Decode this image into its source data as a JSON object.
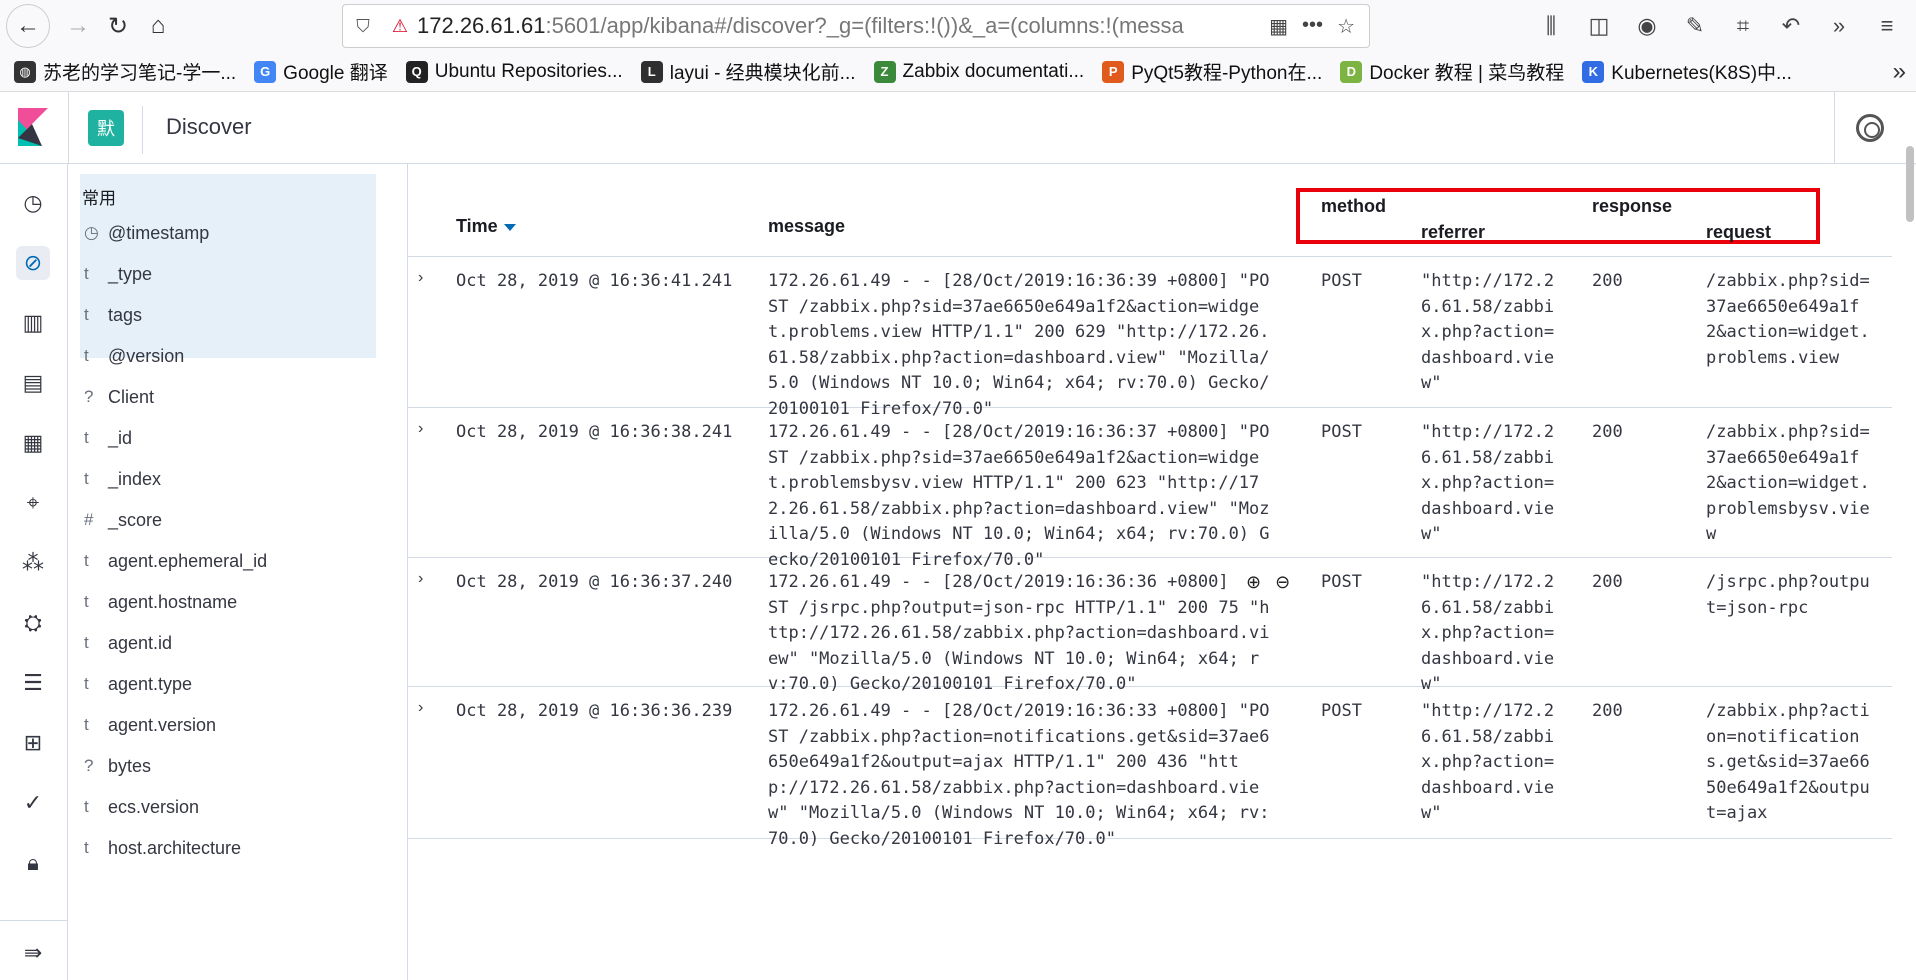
{
  "browser": {
    "url_host": "172.26.61.61",
    "url_rest": ":5601/app/kibana#/discover?_g=(filters:!())&_a=(columns:!(messa",
    "bookmarks": [
      {
        "label": "苏老的学习笔记-学一...",
        "color": "#333333",
        "glyph": "◍"
      },
      {
        "label": "Google 翻译",
        "color": "#4285f4",
        "glyph": "G"
      },
      {
        "label": "Ubuntu Repositories...",
        "color": "#222222",
        "glyph": "Q"
      },
      {
        "label": "layui - 经典模块化前...",
        "color": "#2f2f2f",
        "glyph": "L"
      },
      {
        "label": "Zabbix documentati...",
        "color": "#3b8a3b",
        "glyph": "Z"
      },
      {
        "label": "PyQt5教程-Python在...",
        "color": "#e05a1e",
        "glyph": "P"
      },
      {
        "label": "Docker 教程 | 菜鸟教程",
        "color": "#7cb342",
        "glyph": "D"
      },
      {
        "label": "Kubernetes(K8S)中...",
        "color": "#326ce5",
        "glyph": "K"
      }
    ]
  },
  "kibana": {
    "space_initial": "默",
    "page_title": "Discover"
  },
  "sidebar": {
    "favorites_heading": "常用",
    "favorites": [
      {
        "type": "◷",
        "name": "@timestamp"
      },
      {
        "type": "t",
        "name": "_type"
      },
      {
        "type": "t",
        "name": "tags"
      }
    ],
    "fields": [
      {
        "type": "t",
        "name": "@version"
      },
      {
        "type": "?",
        "name": "Client"
      },
      {
        "type": "t",
        "name": "_id"
      },
      {
        "type": "t",
        "name": "_index"
      },
      {
        "type": "#",
        "name": "_score"
      },
      {
        "type": "t",
        "name": "agent.ephemeral_id"
      },
      {
        "type": "t",
        "name": "agent.hostname"
      },
      {
        "type": "t",
        "name": "agent.id"
      },
      {
        "type": "t",
        "name": "agent.type"
      },
      {
        "type": "t",
        "name": "agent.version"
      },
      {
        "type": "?",
        "name": "bytes"
      },
      {
        "type": "t",
        "name": "ecs.version"
      },
      {
        "type": "t",
        "name": "host.architecture"
      }
    ]
  },
  "table": {
    "headers": {
      "time": "Time",
      "message": "message",
      "method": "method",
      "referrer": "referrer",
      "response": "response",
      "request": "request"
    },
    "rows": [
      {
        "time": "Oct 28, 2019 @ 16:36:41.241",
        "message": "172.26.61.49 - - [28/Oct/2019:16:36:39 +0800] \"PO\nST /zabbix.php?sid=37ae6650e649a1f2&action=widge\nt.problems.view HTTP/1.1\" 200 629 \"http://172.26.\n61.58/zabbix.php?action=dashboard.view\" \"Mozilla/\n5.0 (Windows NT 10.0; Win64; x64; rv:70.0) Gecko/\n20100101 Firefox/70.0\"",
        "method": "POST",
        "referrer": "\"http://172.2\n6.61.58/zabbi\nx.php?action=\ndashboard.vie\nw\"",
        "response": "200",
        "request": "/zabbix.php?sid=\n37ae6650e649a1f\n2&action=widget.\nproblems.view"
      },
      {
        "time": "Oct 28, 2019 @ 16:36:38.241",
        "message": "172.26.61.49 - - [28/Oct/2019:16:36:37 +0800] \"PO\nST /zabbix.php?sid=37ae6650e649a1f2&action=widge\nt.problemsbysv.view HTTP/1.1\" 200 623 \"http://17\n2.26.61.58/zabbix.php?action=dashboard.view\" \"Moz\nilla/5.0 (Windows NT 10.0; Win64; x64; rv:70.0) G\necko/20100101 Firefox/70.0\"",
        "method": "POST",
        "referrer": "\"http://172.2\n6.61.58/zabbi\nx.php?action=\ndashboard.vie\nw\"",
        "response": "200",
        "request": "/zabbix.php?sid=\n37ae6650e649a1f\n2&action=widget.\nproblemsbysv.vie\nw"
      },
      {
        "time": "Oct 28, 2019 @ 16:36:37.240",
        "message": "172.26.61.49 - - [28/Oct/2019:16:36:36 +0800]\nST /jsrpc.php?output=json-rpc HTTP/1.1\" 200 75 \"h\nttp://172.26.61.58/zabbix.php?action=dashboard.vi\new\" \"Mozilla/5.0 (Windows NT 10.0; Win64; x64; r\nv:70.0) Gecko/20100101 Firefox/70.0\"",
        "method": "POST",
        "referrer": "\"http://172.2\n6.61.58/zabbi\nx.php?action=\ndashboard.vie\nw\"",
        "response": "200",
        "request": "/jsrpc.php?outpu\nt=json-rpc"
      },
      {
        "time": "Oct 28, 2019 @ 16:36:36.239",
        "message": "172.26.61.49 - - [28/Oct/2019:16:36:33 +0800] \"PO\nST /zabbix.php?action=notifications.get&sid=37ae6\n650e649a1f2&output=ajax HTTP/1.1\" 200 436 \"htt\np://172.26.61.58/zabbix.php?action=dashboard.vie\nw\" \"Mozilla/5.0 (Windows NT 10.0; Win64; x64; rv:\n70.0) Gecko/20100101 Firefox/70.0\"",
        "method": "POST",
        "referrer": "\"http://172.2\n6.61.58/zabbi\nx.php?action=\ndashboard.vie\nw\"",
        "response": "200",
        "request": "/zabbix.php?acti\non=notification\ns.get&sid=37ae66\n50e649a1f2&outpu\nt=ajax"
      }
    ]
  },
  "colors": {
    "accent": "#006bb4",
    "highlight_box": "#e8000b",
    "space_badge": "#20b2a1"
  }
}
